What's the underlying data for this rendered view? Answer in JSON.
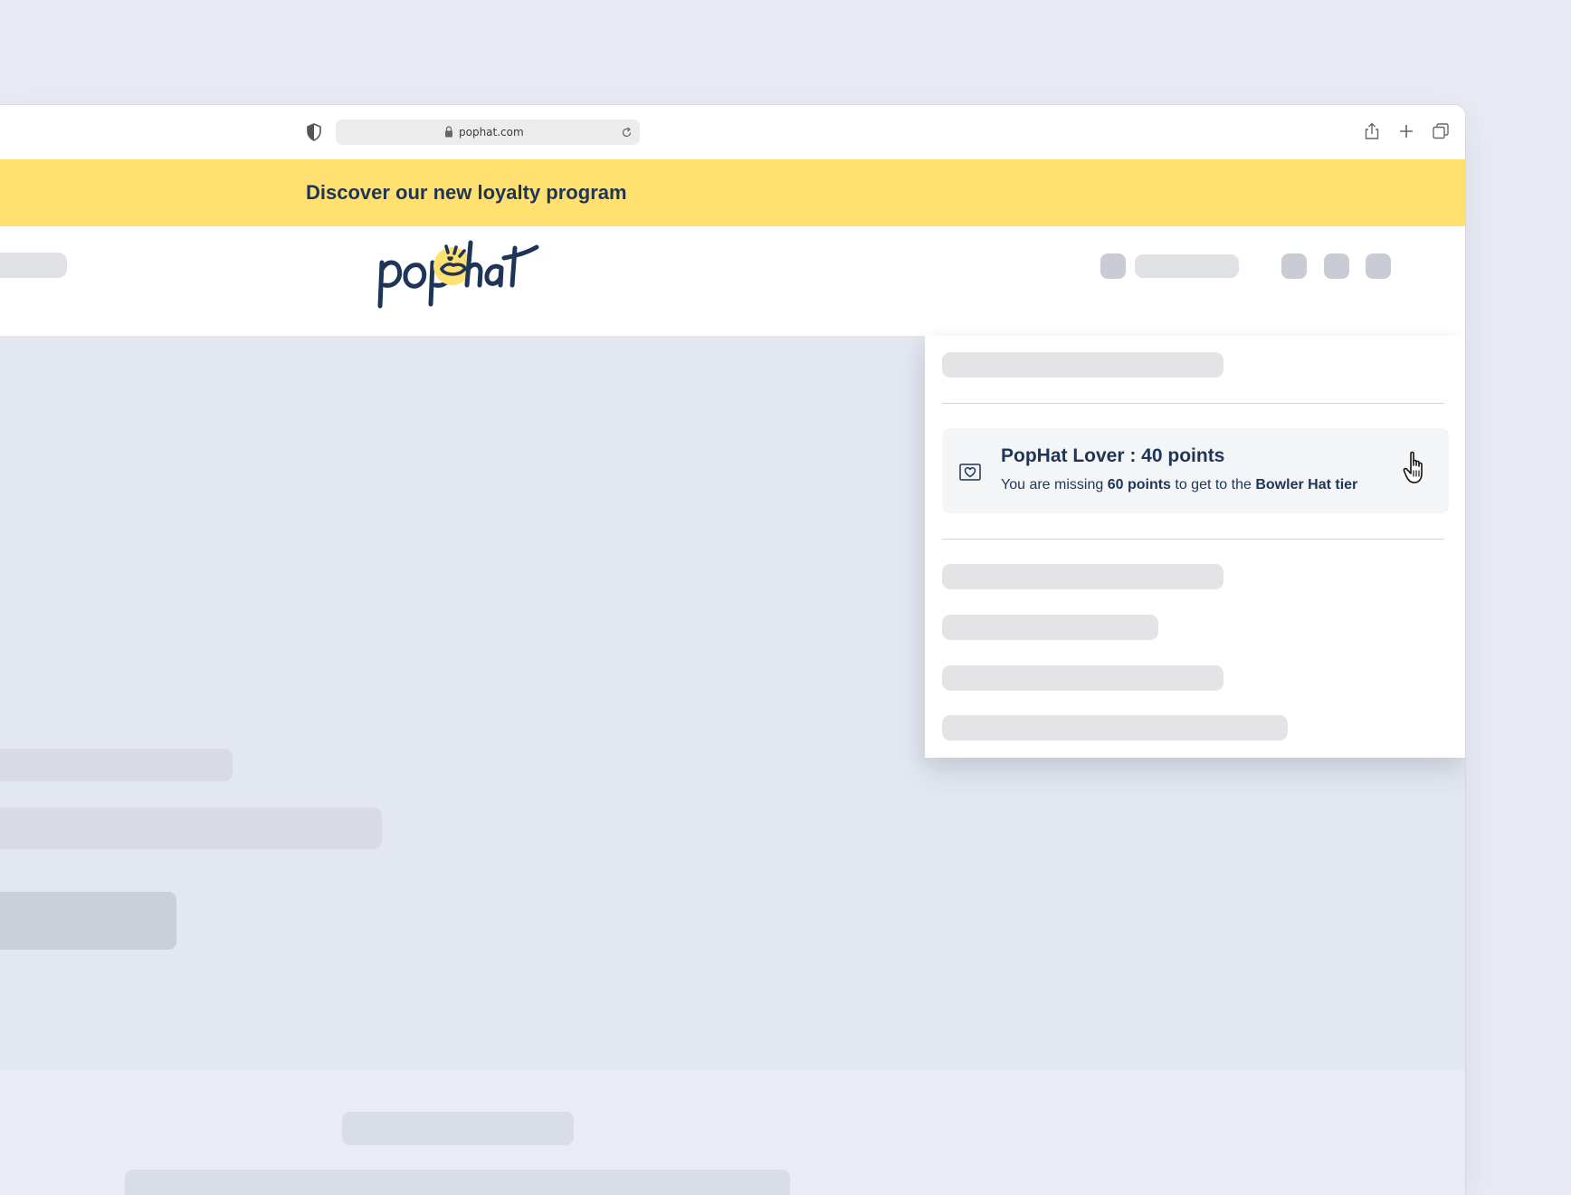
{
  "browser": {
    "url": "pophat.com",
    "icons": [
      "shield-icon",
      "lock-icon",
      "reload-icon",
      "share-icon",
      "new-tab-icon",
      "tabs-icon"
    ]
  },
  "banner": {
    "text": "Discover our new loyalty program",
    "color": "#ffe070"
  },
  "header": {
    "logo_text": "pophat",
    "brand_color": "#1f3558",
    "accent_color": "#ffe070"
  },
  "account_dropdown": {
    "loyalty_card": {
      "icon": "heart-card-icon",
      "title": "PopHat Lover : 40 points",
      "subtitle_prefix": "You are missing ",
      "subtitle_points": "60 points",
      "subtitle_middle": " to get to the ",
      "subtitle_tier": "Bowler Hat tier"
    }
  }
}
